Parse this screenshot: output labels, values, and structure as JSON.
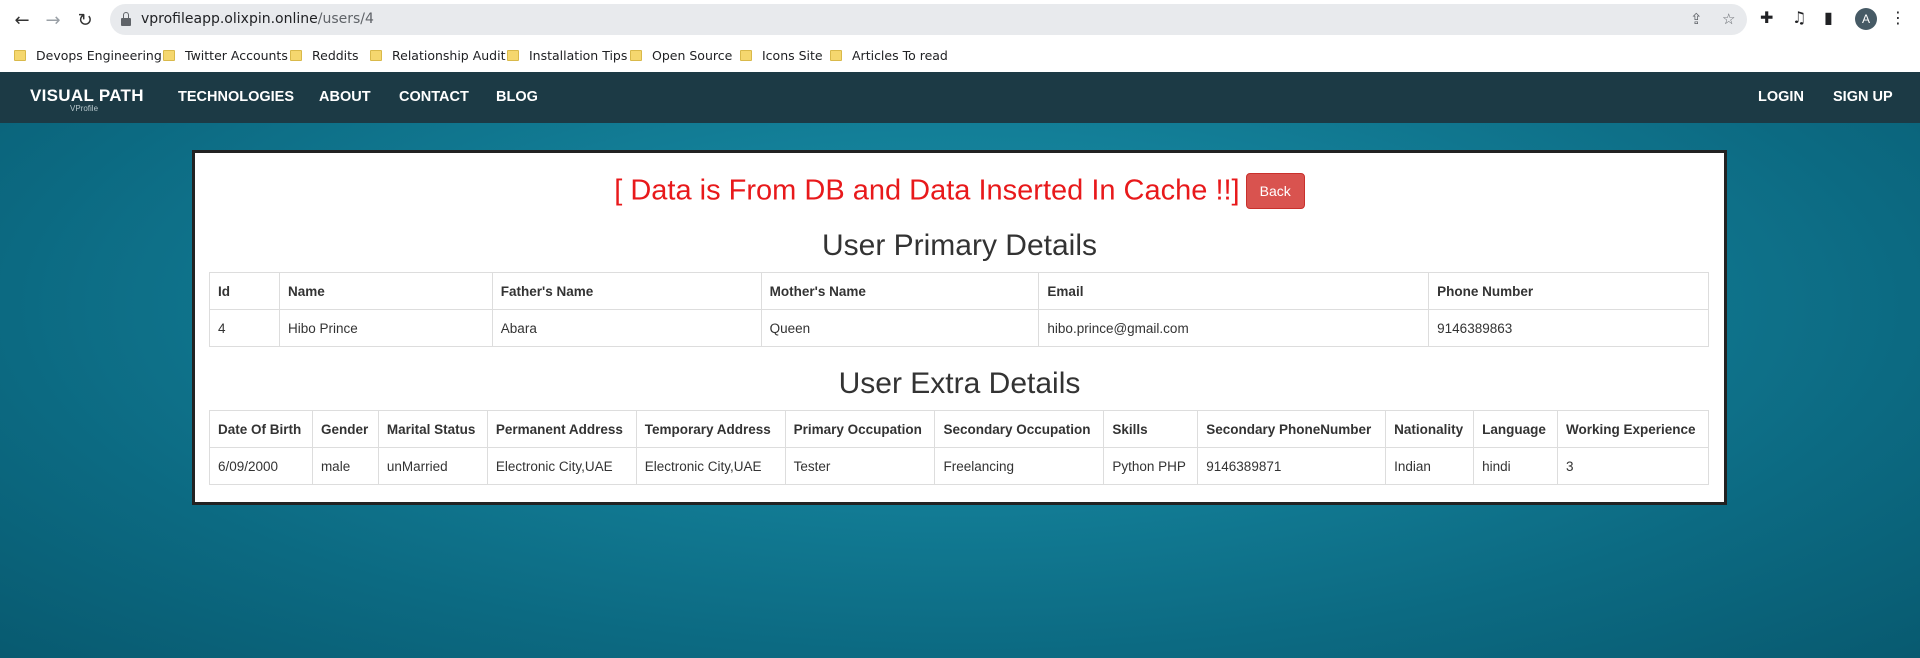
{
  "browser": {
    "url_host": "vprofileapp.olixpin.online",
    "url_path": "/users/4",
    "avatar_letter": "A",
    "bookmarks": [
      {
        "label": "Devops Engineering"
      },
      {
        "label": "Twitter Accounts"
      },
      {
        "label": "Reddits"
      },
      {
        "label": "Relationship Audit"
      },
      {
        "label": "Installation Tips"
      },
      {
        "label": "Open Source"
      },
      {
        "label": "Icons Site"
      },
      {
        "label": "Articles To read"
      }
    ]
  },
  "navbar": {
    "brand": "VISUAL PATH",
    "brand_sub": "VProfile",
    "links": [
      "TECHNOLOGIES",
      "ABOUT",
      "CONTACT",
      "BLOG"
    ],
    "right_links": [
      "LOGIN",
      "SIGN UP"
    ]
  },
  "banner": {
    "text": "[ Data is From DB and Data Inserted In Cache !!]",
    "back_label": "Back",
    "color": "#e8191b"
  },
  "primary": {
    "title": "User Primary Details",
    "headers": [
      "Id",
      "Name",
      "Father's Name",
      "Mother's Name",
      "Email",
      "Phone Number"
    ],
    "row": [
      "4",
      "Hibo Prince",
      "Abara",
      "Queen",
      "hibo.prince@gmail.com",
      "9146389863"
    ]
  },
  "extra": {
    "title": "User Extra Details",
    "headers": [
      "Date Of Birth",
      "Gender",
      "Marital Status",
      "Permanent Address",
      "Temporary Address",
      "Primary Occupation",
      "Secondary Occupation",
      "Skills",
      "Secondary PhoneNumber",
      "Nationality",
      "Language",
      "Working Experience"
    ],
    "row": [
      "6/09/2000",
      "male",
      "unMarried",
      "Electronic City,UAE",
      "Electronic City,UAE",
      "Tester",
      "Freelancing",
      "Python PHP",
      "9146389871",
      "Indian",
      "hindi",
      "3"
    ]
  }
}
